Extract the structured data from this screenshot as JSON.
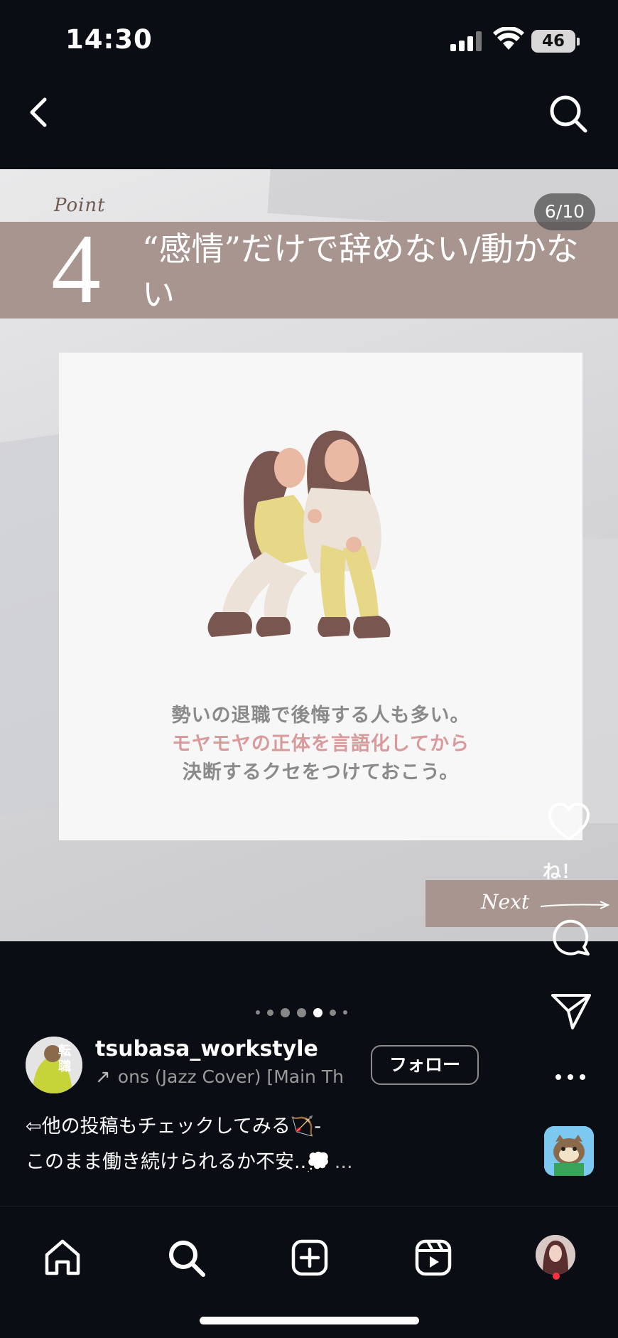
{
  "status": {
    "time": "14:30",
    "battery": "46"
  },
  "nav": {
    "back_icon": "chevron-left-icon",
    "search_icon": "search-icon"
  },
  "slide": {
    "point_label": "Point",
    "point_number": "4",
    "title": "“感情”だけで辞めない/動かない",
    "counter": "6/10",
    "line1": "勢いの退職で後悔する人も多い。",
    "line2": "モヤモヤの正体を言語化してから",
    "line3": "決断するクセをつけておこう。",
    "next_label": "Next",
    "faded_overlay": "ね！",
    "accent_color": "#a89590",
    "highlight_color": "#d99a9b"
  },
  "carousel": {
    "total_dots": 7,
    "active_index": 4
  },
  "author": {
    "username": "tsubasa_workstyle",
    "avatar_text": "転職",
    "music": "ons (Jazz Cover) [Main Th",
    "follow_label": "フォロー"
  },
  "caption": {
    "line1": "⇦他の投稿もチェックしてみる🏹-",
    "line2": "このまま働き続けられるか不安..💭",
    "more": "..."
  },
  "actions": {
    "like_icon": "heart-icon",
    "comment_icon": "comment-icon",
    "share_icon": "send-icon",
    "more_icon": "more-horizontal-icon"
  },
  "tabbar": {
    "items": [
      "home-icon",
      "search-icon",
      "create-icon",
      "reels-icon",
      "profile-avatar"
    ]
  }
}
